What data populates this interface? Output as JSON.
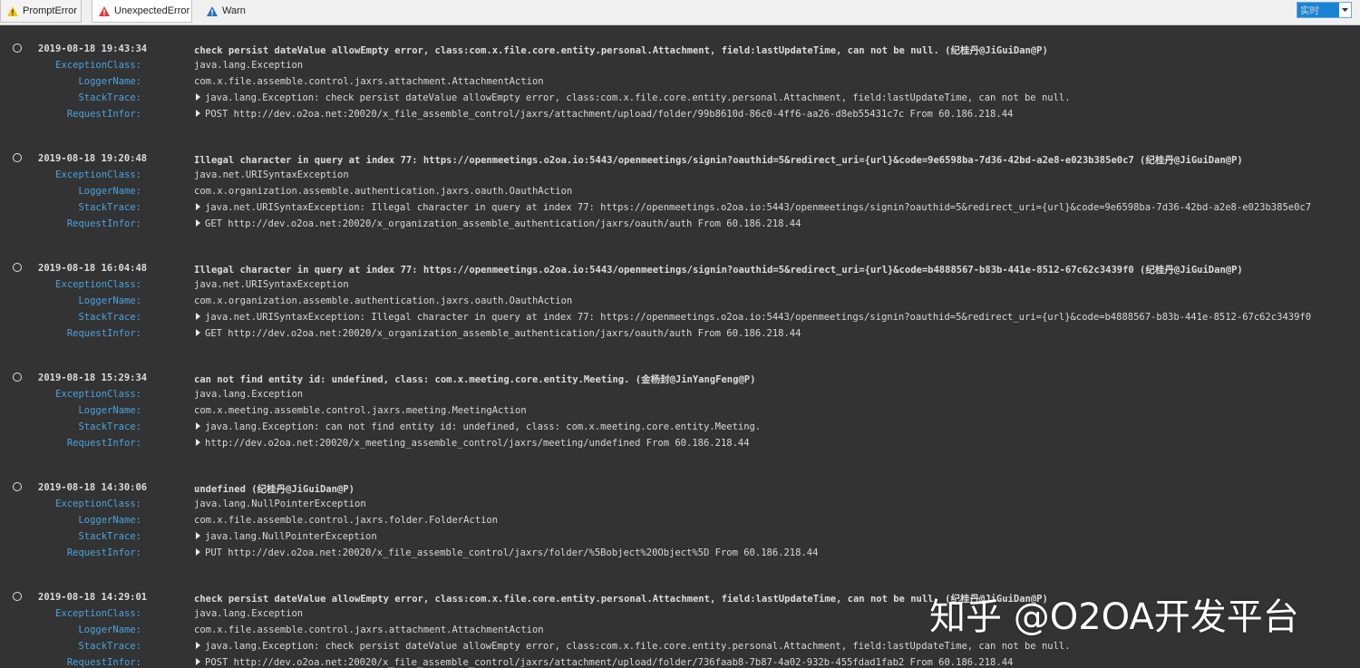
{
  "toolbar": {
    "tabs": [
      {
        "label": "PromptError",
        "icon": "warning-icon",
        "color": "#f5c400"
      },
      {
        "label": "UnexpectedError",
        "icon": "error-icon",
        "color": "#e03c3c"
      },
      {
        "label": "Warn",
        "icon": "warn-icon",
        "color": "#2a6fc4"
      }
    ],
    "mode_select": {
      "value": "实时"
    }
  },
  "labels": {
    "exception_class": "ExceptionClass:",
    "logger_name": "LoggerName:",
    "stack_trace": "StackTrace:",
    "request_infor": "RequestInfor:"
  },
  "entries": [
    {
      "time": "2019-08-18 19:43:34",
      "message": "check persist dateValue allowEmpty error, class:com.x.file.core.entity.personal.Attachment, field:lastUpdateTime, can not be null. (纪桂丹@JiGuiDan@P)",
      "exception_class": "java.lang.Exception",
      "logger_name": "com.x.file.assemble.control.jaxrs.attachment.AttachmentAction",
      "stack_trace": "java.lang.Exception: check persist dateValue allowEmpty error, class:com.x.file.core.entity.personal.Attachment, field:lastUpdateTime, can not be null.",
      "request_infor": "POST http://dev.o2oa.net:20020/x_file_assemble_control/jaxrs/attachment/upload/folder/99b8610d-86c0-4ff6-aa26-d8eb55431c7c  From  60.186.218.44"
    },
    {
      "time": "2019-08-18 19:20:48",
      "message": "Illegal character in query at index 77: https://openmeetings.o2oa.io:5443/openmeetings/signin?oauthid=5&redirect_uri={url}&code=9e6598ba-7d36-42bd-a2e8-e023b385e0c7 (纪桂丹@JiGuiDan@P)",
      "exception_class": "java.net.URISyntaxException",
      "logger_name": "com.x.organization.assemble.authentication.jaxrs.oauth.OauthAction",
      "stack_trace": "java.net.URISyntaxException: Illegal character in query at index 77: https://openmeetings.o2oa.io:5443/openmeetings/signin?oauthid=5&redirect_uri={url}&code=9e6598ba-7d36-42bd-a2e8-e023b385e0c7",
      "request_infor": "GET http://dev.o2oa.net:20020/x_organization_assemble_authentication/jaxrs/oauth/auth  From  60.186.218.44"
    },
    {
      "time": "2019-08-18 16:04:48",
      "message": "Illegal character in query at index 77: https://openmeetings.o2oa.io:5443/openmeetings/signin?oauthid=5&redirect_uri={url}&code=b4888567-b83b-441e-8512-67c62c3439f0 (纪桂丹@JiGuiDan@P)",
      "exception_class": "java.net.URISyntaxException",
      "logger_name": "com.x.organization.assemble.authentication.jaxrs.oauth.OauthAction",
      "stack_trace": "java.net.URISyntaxException: Illegal character in query at index 77: https://openmeetings.o2oa.io:5443/openmeetings/signin?oauthid=5&redirect_uri={url}&code=b4888567-b83b-441e-8512-67c62c3439f0",
      "request_infor": "GET http://dev.o2oa.net:20020/x_organization_assemble_authentication/jaxrs/oauth/auth  From  60.186.218.44"
    },
    {
      "time": "2019-08-18 15:29:34",
      "message": "can not find entity id: undefined, class: com.x.meeting.core.entity.Meeting. (金杨封@JinYangFeng@P)",
      "exception_class": "java.lang.Exception",
      "logger_name": "com.x.meeting.assemble.control.jaxrs.meeting.MeetingAction",
      "stack_trace": "java.lang.Exception: can not find entity id: undefined, class: com.x.meeting.core.entity.Meeting.",
      "request_infor": "http://dev.o2oa.net:20020/x_meeting_assemble_control/jaxrs/meeting/undefined  From  60.186.218.44"
    },
    {
      "time": "2019-08-18 14:30:06",
      "message": "undefined (纪桂丹@JiGuiDan@P)",
      "exception_class": "java.lang.NullPointerException",
      "logger_name": "com.x.file.assemble.control.jaxrs.folder.FolderAction",
      "stack_trace": "java.lang.NullPointerException",
      "request_infor": "PUT http://dev.o2oa.net:20020/x_file_assemble_control/jaxrs/folder/%5Bobject%20Object%5D  From  60.186.218.44"
    },
    {
      "time": "2019-08-18 14:29:01",
      "message": "check persist dateValue allowEmpty error, class:com.x.file.core.entity.personal.Attachment, field:lastUpdateTime, can not be null. (纪桂丹@JiGuiDan@P)",
      "exception_class": "java.lang.Exception",
      "logger_name": "com.x.file.assemble.control.jaxrs.attachment.AttachmentAction",
      "stack_trace": "java.lang.Exception: check persist dateValue allowEmpty error, class:com.x.file.core.entity.personal.Attachment, field:lastUpdateTime, can not be null.",
      "request_infor": "POST http://dev.o2oa.net:20020/x_file_assemble_control/jaxrs/attachment/upload/folder/736faab8-7b87-4a02-932b-455fdad1fab2  From  60.186.218.44"
    }
  ],
  "watermark": "知乎 @O2OA开发平台"
}
